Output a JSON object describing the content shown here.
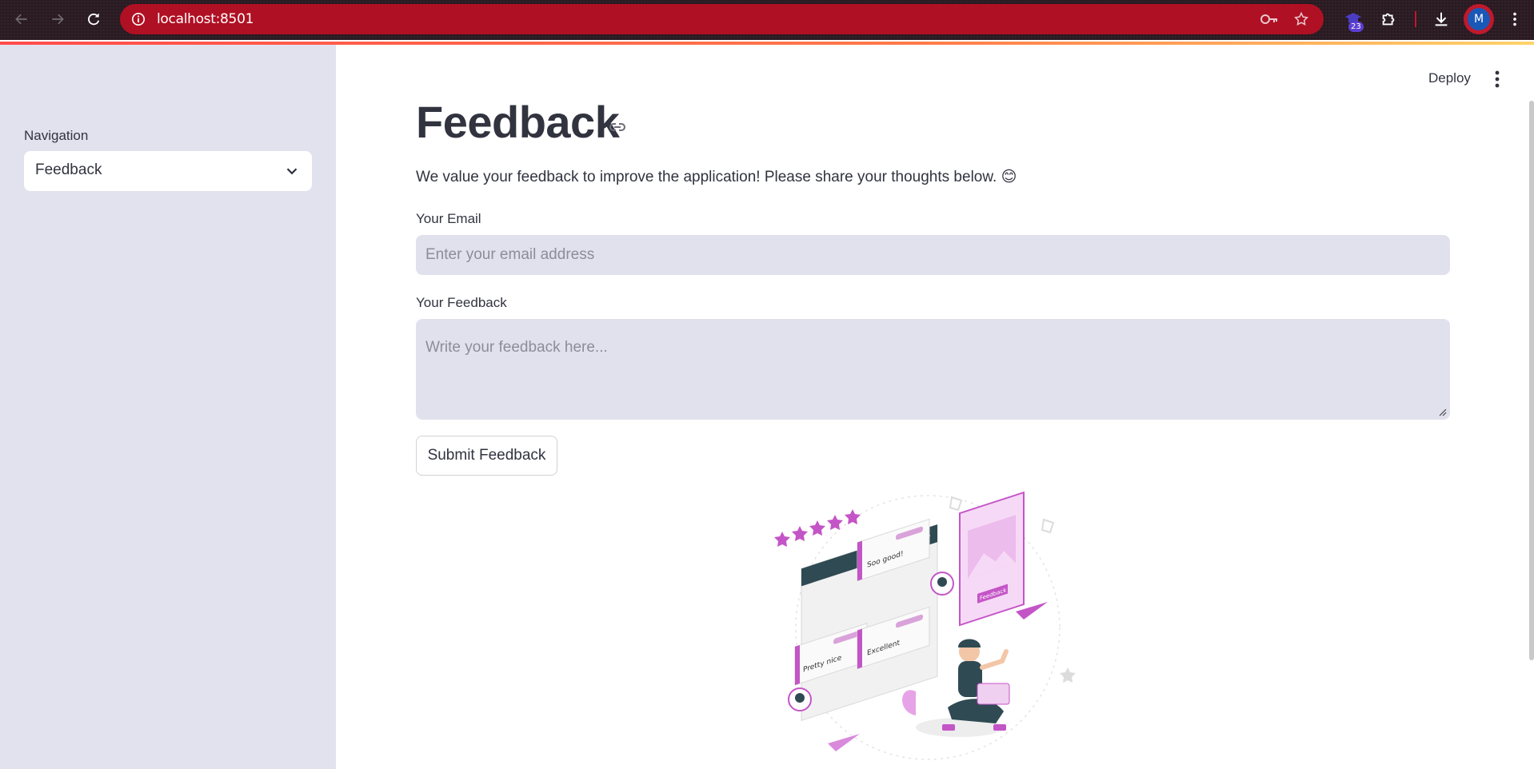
{
  "browser": {
    "url": "localhost:8501",
    "extension_badge": "23",
    "profile_initial": "M",
    "accent_color": "#b01023"
  },
  "sidebar": {
    "nav_label": "Navigation",
    "nav_selected": "Feedback"
  },
  "header": {
    "deploy_label": "Deploy"
  },
  "main": {
    "title": "Feedback",
    "intro": "We value your feedback to improve the application! Please share your thoughts below. 😊",
    "email_label": "Your Email",
    "email_placeholder": "Enter your email address",
    "feedback_label": "Your Feedback",
    "feedback_placeholder": "Write your feedback here...",
    "submit_label": "Submit Feedback"
  },
  "illustration": {
    "bubble_texts": [
      "Soo good!",
      "Pretty nice",
      "Excellent",
      "Feedback"
    ],
    "star_count": 5,
    "accent_color": "#c455c7"
  }
}
